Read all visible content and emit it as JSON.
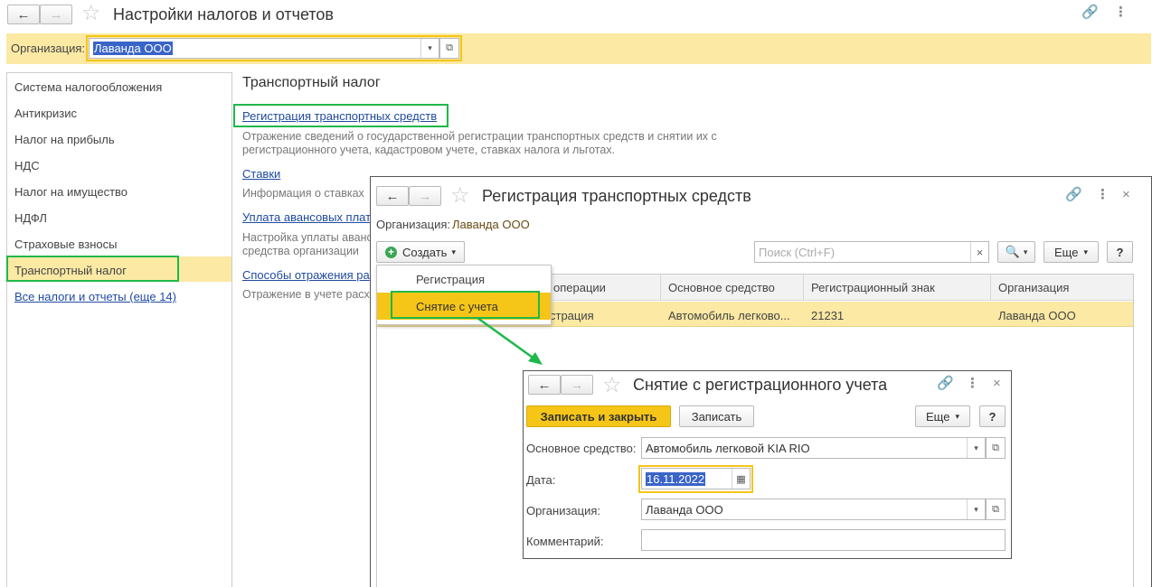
{
  "main": {
    "title": "Настройки налогов и отчетов",
    "org_label": "Организация:",
    "org_value": "Лаванда ООО"
  },
  "sidebar": {
    "items": [
      {
        "label": "Система налогообложения"
      },
      {
        "label": "Антикризис"
      },
      {
        "label": "Налог на прибыль"
      },
      {
        "label": "НДС"
      },
      {
        "label": "Налог на имущество"
      },
      {
        "label": "НДФЛ"
      },
      {
        "label": "Страховые взносы"
      },
      {
        "label": "Транспортный налог"
      }
    ],
    "all_link": "Все налоги и отчеты (еще 14)"
  },
  "content": {
    "heading": "Транспортный налог",
    "links": [
      {
        "label": "Регистрация транспортных средств",
        "desc1": "Отражение сведений о государственной регистрации транспортных средств и снятии их с",
        "desc2": "регистрационного учета, кадастровом учете, ставках налога и льготах."
      },
      {
        "label": "Ставки",
        "desc1": "Информация о ставках",
        "desc2": ""
      },
      {
        "label": "Уплата авансовых плат",
        "desc1": "Настройка уплаты аванс",
        "desc2": "средства организации"
      },
      {
        "label": "Способы отражения ра",
        "desc1": "Отражение в учете расх",
        "desc2": ""
      }
    ]
  },
  "reg_window": {
    "title": "Регистрация транспортных средств",
    "org_label": "Организация:",
    "org_value": "Лаванда ООО",
    "create_label": "Создать",
    "search_placeholder": "Поиск (Ctrl+F)",
    "more_label": "Еще",
    "help_label": "?",
    "columns": [
      "операции",
      "Основное средство",
      "Регистрационный знак",
      "Организация"
    ],
    "row": [
      "страция",
      "Автомобиль легково...",
      "21231",
      "Лаванда ООО"
    ],
    "menu": [
      "Регистрация",
      "Снятие с учета"
    ]
  },
  "dereg_window": {
    "title": "Снятие с регистрационного учета",
    "save_close_label": "Записать и закрыть",
    "save_label": "Записать",
    "more_label": "Еще",
    "help_label": "?",
    "asset_label": "Основное средство:",
    "asset_value": "Автомобиль легковой KIA RIO",
    "date_label": "Дата:",
    "date_value": "16.11.2022",
    "org_label": "Организация:",
    "org_value": "Лаванда ООО",
    "comment_label": "Комментарий:",
    "comment_value": ""
  },
  "colors": {
    "highlight": "#fbe9a4",
    "accent_yellow": "#f5c518",
    "annotation_green": "#1fb84a",
    "link": "#1f4aa0"
  }
}
